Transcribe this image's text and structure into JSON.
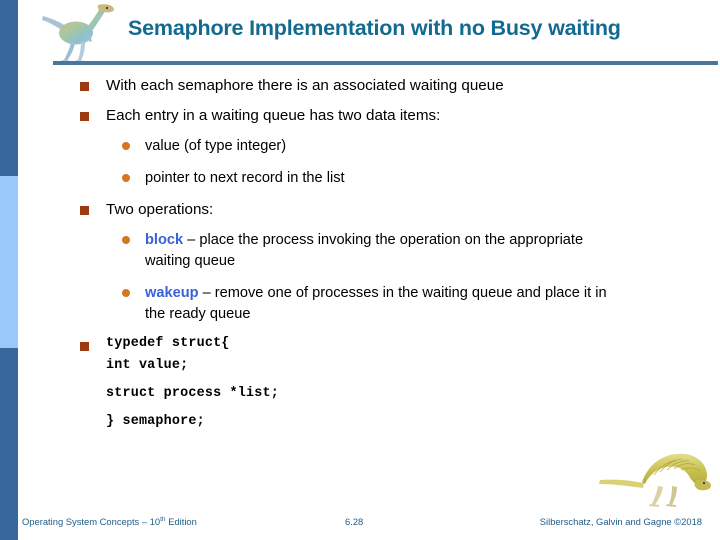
{
  "slide": {
    "title": "Semaphore Implementation with no Busy waiting",
    "title_color": "#136A91",
    "rule_color": "#4A7699",
    "rail_dark_color": "#36689B",
    "rail_light_color": "#9AC8FB",
    "level1_bullet_color": "#9C3A12",
    "level2_bullet_color": "#D4771F",
    "keyword_color": "#3A62D8"
  },
  "logo": {
    "top_left_icon": "gallimimus-dinosaur-icon",
    "bottom_right_icon": "spinosaurus-dinosaur-icon"
  },
  "content": {
    "b1": "With each semaphore there is an associated waiting queue",
    "b2": "Each entry in a waiting queue has two data items:",
    "s1": "value (of type integer)",
    "s2": "pointer to next record in the list",
    "b3": "Two operations:",
    "s3_keyword": "block",
    "s3_rest": " – place the process invoking the operation on the appropriate waiting queue",
    "s4_keyword": "wakeup",
    "s4_rest": " – remove one of processes in the waiting queue and place it in the ready queue",
    "code_line1": "typedef struct{",
    "code_line2": "int value;",
    "code_line3": "struct process *list;",
    "code_line4": "} semaphore;"
  },
  "footer": {
    "left_prefix": "Operating System Concepts – 10",
    "left_sup": "th",
    "left_suffix": " Edition",
    "page_number": "6.28",
    "right": "Silberschatz, Galvin and Gagne ©2018"
  }
}
